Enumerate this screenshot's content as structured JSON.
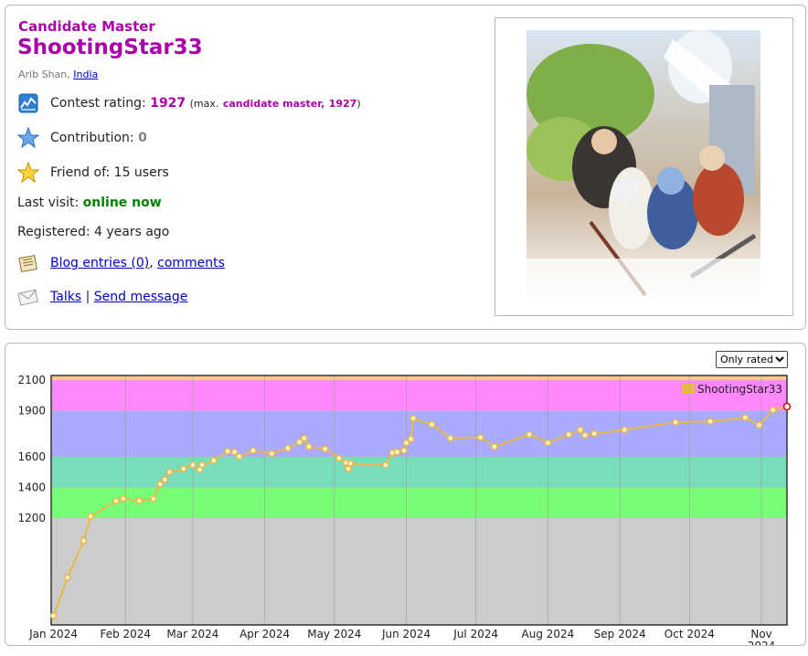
{
  "profile": {
    "rank": "Candidate Master",
    "handle": "ShootingStar33",
    "real_name": "Arib Shan,",
    "country": "India",
    "contest_rating_label": "Contest rating:",
    "rating": "1927",
    "max_prefix": "(max.",
    "max_rank": "candidate master,",
    "max_rating": "1927",
    "max_suffix": ")",
    "contribution_label": "Contribution:",
    "contribution": "0",
    "friend_of": "Friend of: 15 users",
    "last_visit_label": "Last visit:",
    "last_visit": "online now",
    "registered": "Registered: 4 years ago",
    "blog_entries": "Blog entries (0)",
    "comma": ",",
    "comments": "comments",
    "talks": "Talks",
    "separator": "|",
    "send_message": "Send message"
  },
  "icons": {
    "rating": "rating-chart-icon",
    "contribution": "blue-star-icon",
    "friends": "gold-star-icon",
    "blog": "blog-icon",
    "talks": "envelope-icon"
  },
  "rating_filter": {
    "selected": "Only rated",
    "options": [
      "Only rated"
    ]
  },
  "colors": {
    "handle": "#aa00aa",
    "link": "#0000cc",
    "online": "#008000",
    "line": "#e8b84a",
    "bands": [
      "#cccccc",
      "#77ff77",
      "#77ddbb",
      "#aaaaff",
      "#ff88ff",
      "#ffcc88"
    ]
  },
  "chart_data": {
    "type": "line",
    "legend": "ShootingStar33",
    "legend_position": "top-right",
    "y_ticks": [
      1200,
      1400,
      1600,
      1900,
      2100
    ],
    "x_ticks": [
      "Jan 2024",
      "Feb 2024",
      "Mar 2024",
      "Apr 2024",
      "May 2024",
      "Jun 2024",
      "Jul 2024",
      "Aug 2024",
      "Sep 2024",
      "Oct 2024",
      "Nov\n2024"
    ],
    "ylim": [
      500,
      2130
    ],
    "rating_bands": [
      {
        "from": 0,
        "to": 1200,
        "color": "#cccccc"
      },
      {
        "from": 1200,
        "to": 1400,
        "color": "#77ff77"
      },
      {
        "from": 1400,
        "to": 1600,
        "color": "#77ddbb"
      },
      {
        "from": 1600,
        "to": 1900,
        "color": "#aaaaff"
      },
      {
        "from": 1900,
        "to": 2100,
        "color": "#ff88ff"
      },
      {
        "from": 2100,
        "to": 2300,
        "color": "#ffcc88"
      }
    ],
    "series": [
      {
        "name": "ShootingStar33",
        "points": [
          [
            "2024-01-01",
            560
          ],
          [
            "2024-01-07",
            810
          ],
          [
            "2024-01-14",
            1050
          ],
          [
            "2024-01-17",
            1210
          ],
          [
            "2024-01-28",
            1310
          ],
          [
            "2024-01-31",
            1325
          ],
          [
            "2024-02-07",
            1310
          ],
          [
            "2024-02-13",
            1325
          ],
          [
            "2024-02-16",
            1420
          ],
          [
            "2024-02-18",
            1450
          ],
          [
            "2024-02-20",
            1500
          ],
          [
            "2024-02-26",
            1520
          ],
          [
            "2024-03-01",
            1545
          ],
          [
            "2024-03-04",
            1515
          ],
          [
            "2024-03-05",
            1545
          ],
          [
            "2024-03-10",
            1575
          ],
          [
            "2024-03-16",
            1635
          ],
          [
            "2024-03-19",
            1630
          ],
          [
            "2024-03-21",
            1600
          ],
          [
            "2024-03-27",
            1640
          ],
          [
            "2024-04-04",
            1620
          ],
          [
            "2024-04-11",
            1655
          ],
          [
            "2024-04-16",
            1695
          ],
          [
            "2024-04-18",
            1720
          ],
          [
            "2024-04-20",
            1665
          ],
          [
            "2024-04-27",
            1650
          ],
          [
            "2024-05-03",
            1590
          ],
          [
            "2024-05-06",
            1560
          ],
          [
            "2024-05-07",
            1520
          ],
          [
            "2024-05-08",
            1555
          ],
          [
            "2024-05-23",
            1545
          ],
          [
            "2024-05-26",
            1625
          ],
          [
            "2024-05-28",
            1630
          ],
          [
            "2024-05-31",
            1640
          ],
          [
            "2024-06-01",
            1690
          ],
          [
            "2024-06-03",
            1715
          ],
          [
            "2024-06-04",
            1850
          ],
          [
            "2024-06-12",
            1810
          ],
          [
            "2024-06-20",
            1720
          ],
          [
            "2024-07-03",
            1725
          ],
          [
            "2024-07-09",
            1665
          ],
          [
            "2024-07-24",
            1745
          ],
          [
            "2024-08-01",
            1690
          ],
          [
            "2024-08-10",
            1745
          ],
          [
            "2024-08-15",
            1775
          ],
          [
            "2024-08-17",
            1740
          ],
          [
            "2024-08-21",
            1750
          ],
          [
            "2024-09-03",
            1775
          ],
          [
            "2024-09-25",
            1825
          ],
          [
            "2024-10-10",
            1830
          ],
          [
            "2024-10-25",
            1855
          ],
          [
            "2024-10-31",
            1805
          ],
          [
            "2024-11-06",
            1905
          ],
          [
            "2024-11-12",
            1927
          ]
        ]
      }
    ]
  }
}
